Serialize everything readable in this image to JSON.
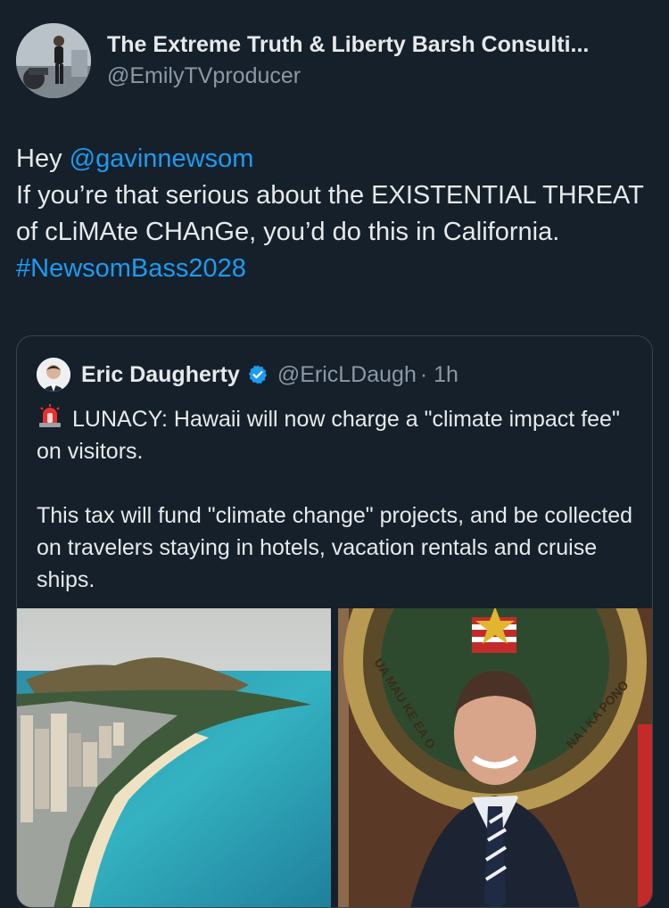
{
  "author": {
    "display_name": "The Extreme Truth & Liberty Barsh Consulti...",
    "handle": "@EmilyTVproducer"
  },
  "tweet": {
    "greeting": "Hey",
    "mention": "@gavinnewsom",
    "body": "If you’re that serious about the EXISTENTIAL THREAT of cLiMAte CHAnGe, you’d do this in California.",
    "hashtag": "#NewsomBass2028"
  },
  "quoted_tweet": {
    "display_name": "Eric Daugherty",
    "handle": "@EricLDaugh",
    "time": "· 1h",
    "paragraph1": "LUNACY: Hawaii will now charge a \"climate impact fee\" on visitors.",
    "paragraph2": "This tax will fund \"climate change\" projects, and be collected on travelers staying in hotels, vacation rentals and cruise ships."
  },
  "seal_text": {
    "left": "UA MAU KE EA O",
    "right": "NA I KA PONO"
  },
  "icons": {
    "verified": "verified-badge-icon",
    "siren": "siren-emoji-icon"
  },
  "colors": {
    "background": "#15202b",
    "link": "#1d9bf0",
    "verified": "#1d9bf0",
    "muted": "#8b98a5",
    "border": "#38444d"
  }
}
